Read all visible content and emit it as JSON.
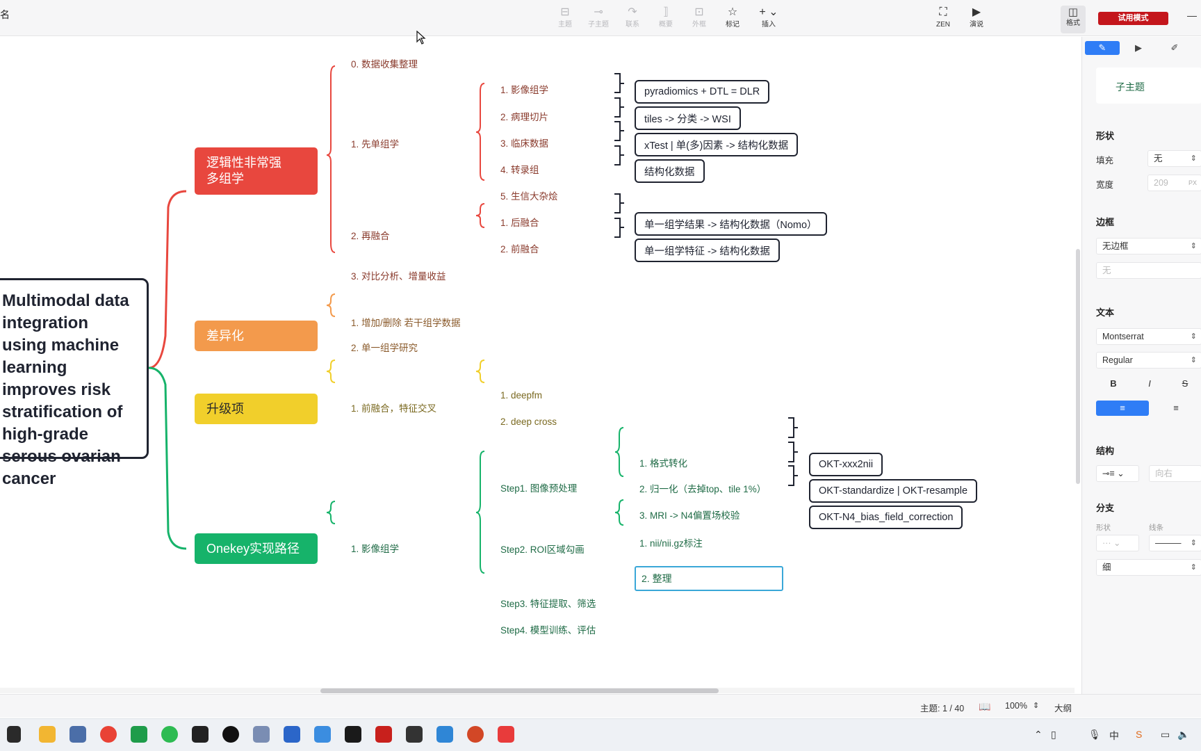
{
  "window": {
    "title_fragment": "名"
  },
  "toolbar": {
    "buttons": [
      {
        "label": "主题",
        "icon": "topic-icon",
        "glyph": "⊟"
      },
      {
        "label": "子主题",
        "icon": "subtopic-icon",
        "glyph": "⊸"
      },
      {
        "label": "联系",
        "icon": "relationship-icon",
        "glyph": "↷"
      },
      {
        "label": "概要",
        "icon": "summary-icon",
        "glyph": "⟧"
      },
      {
        "label": "外框",
        "icon": "boundary-icon",
        "glyph": "⊡"
      },
      {
        "label": "标记",
        "icon": "star-icon",
        "glyph": "☆"
      },
      {
        "label": "插入",
        "icon": "insert-icon",
        "glyph": "+ ⌄"
      },
      {
        "label": "ZEN",
        "icon": "zen-icon",
        "glyph": "⛶"
      },
      {
        "label": "演说",
        "icon": "pitch-icon",
        "glyph": "▶"
      }
    ],
    "format_label": "格式",
    "trial_label": "试用模式",
    "minimize": "—"
  },
  "mindmap": {
    "root": "Multimodal data integration using machine learning improves risk stratification of high-grade serous ovarian cancer",
    "branches": [
      {
        "label": "逻辑性非常强\n多组学",
        "color": "#e8473e"
      },
      {
        "label": "差异化",
        "color": "#f39a4c"
      },
      {
        "label": "升级项",
        "color": "#f1cf2b"
      },
      {
        "label": "Onekey实现路径",
        "color": "#16b36a"
      }
    ],
    "b1": {
      "l1": [
        "0. 数据收集整理",
        "1. 先单组学",
        "2. 再融合",
        "3. 对比分析、增量收益"
      ],
      "single": [
        "1. 影像组学",
        "2. 病理切片",
        "3. 临床数据",
        "4. 转录组",
        "5. 生信大杂烩"
      ],
      "single_notes": [
        "pyradiomics + DTL = DLR",
        "tiles -> 分类 -> WSI",
        "xTest | 单(多)因素 -> 结构化数据",
        "结构化数据"
      ],
      "fusion": [
        "1. 后融合",
        "2. 前融合"
      ],
      "fusion_notes": [
        "单一组学结果 -> 结构化数据（Nomo）",
        "单一组学特征 -> 结构化数据"
      ]
    },
    "b2": {
      "l1": [
        "1. 增加/删除 若干组学数据",
        "2. 单一组学研究"
      ]
    },
    "b3": {
      "l1": [
        "1. 前融合，特征交叉"
      ],
      "l2": [
        "1. deepfm",
        "2. deep cross"
      ]
    },
    "b4": {
      "l1": [
        "1. 影像组学"
      ],
      "steps": [
        "Step1. 图像预处理",
        "Step2. ROI区域勾画",
        "Step3. 特征提取、筛选",
        "Step4. 模型训练、评估"
      ],
      "step1": [
        "1. 格式转化",
        "2. 归一化（去掉top、tile 1%）",
        "3. MRI -> N4偏置场校验"
      ],
      "step1_notes": [
        "OKT-xxx2nii",
        "OKT-standardize | OKT-resample",
        "OKT-N4_bias_field_correction"
      ],
      "step2": [
        "1. nii/nii.gz标注",
        "2. 整理"
      ]
    }
  },
  "statusbar": {
    "topic_count": "主题: 1 / 40",
    "zoom": "100%",
    "outline": "大纲"
  },
  "panel": {
    "tabs": [
      "style-icon",
      "slide-icon",
      "note-icon"
    ],
    "card": "子主题",
    "shape_section": "形状",
    "fill_label": "填充",
    "fill_value": "无",
    "width_label": "宽度",
    "width_value": "209",
    "width_unit": "PX",
    "border_section": "边框",
    "border_value": "无边框",
    "border_sub": "无",
    "text_section": "文本",
    "font": "Montserrat",
    "weight": "Regular",
    "structure_section": "结构",
    "structure_dir": "向右",
    "branch_section": "分支",
    "branch_shape_label": "形状",
    "branch_line_label": "线条",
    "branch_thickness": "细"
  },
  "colors": {
    "accent": "#2f7df6",
    "trial": "#c4161c",
    "red": "#e8473e",
    "orange": "#f39a4c",
    "yellow": "#f1cf2b",
    "green": "#16b36a"
  }
}
